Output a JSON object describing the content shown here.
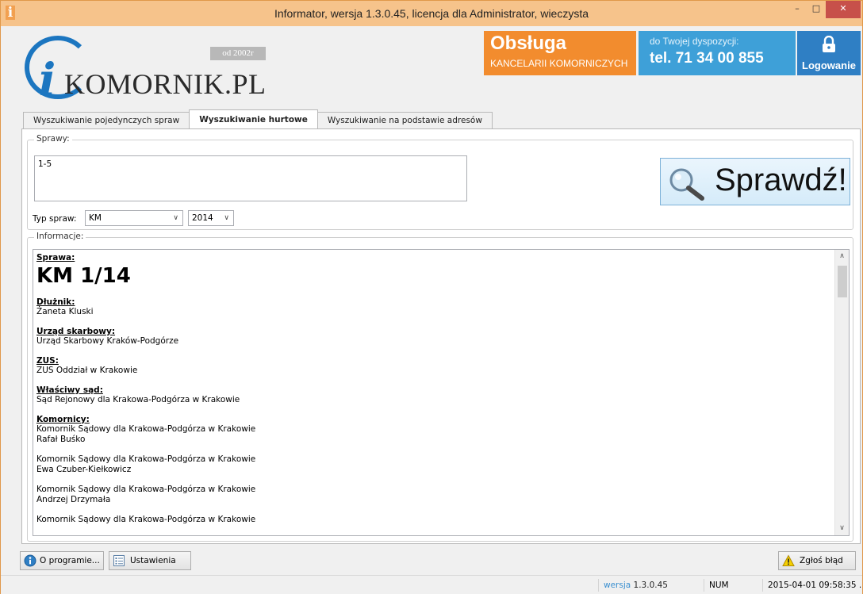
{
  "window": {
    "title": "Informator, wersja 1.3.0.45, licencja dla Administrator, wieczysta",
    "app_icon": "i",
    "min_label": "–",
    "max_label": "□",
    "close_label": "✕"
  },
  "header": {
    "logo_letter": "i",
    "logo_text": "KOMORNIK.PL",
    "logo_since": "od 2002r",
    "service_title": "Obsługa",
    "service_subtitle": "KANCELARII KOMORNICZYCH",
    "phone_label": "do Twojej dyspozycji:",
    "phone_number": "tel. 71 34 00 855",
    "login_label": "Logowanie",
    "colors": {
      "orange": "#f28c2e",
      "blue_light": "#3ea0d8",
      "blue_dark": "#2f7fc4"
    }
  },
  "tabs": [
    {
      "label": "Wyszukiwanie pojedynczych spraw",
      "active": false
    },
    {
      "label": "Wyszukiwanie hurtowe",
      "active": true
    },
    {
      "label": "Wyszukiwanie na podstawie adresów",
      "active": false
    }
  ],
  "sprawy": {
    "group_label": "Sprawy:",
    "input_value": "1-5",
    "type_label": "Typ spraw:",
    "type_selected": "KM",
    "year_selected": "2014",
    "check_button": "Sprawdź!"
  },
  "info": {
    "group_label": "Informacje:",
    "sprawa_label": "Sprawa:",
    "case_number": "KM 1/14",
    "dluznik_label": "Dłużnik:",
    "dluznik": "Żaneta Kluski",
    "urzad_label": "Urząd skarbowy:",
    "urzad": "Urząd Skarbowy Kraków-Podgórze",
    "zus_label": "ZUS:",
    "zus": "ZUS Oddział w Krakowie",
    "sad_label": "Właściwy sąd:",
    "sad": "Sąd Rejonowy dla Krakowa-Podgórza w Krakowie",
    "komornicy_label": "Komornicy:",
    "komornicy": [
      {
        "office": "Komornik Sądowy dla Krakowa-Podgórza w Krakowie",
        "name": "Rafał Buśko"
      },
      {
        "office": "Komornik Sądowy dla Krakowa-Podgórza w Krakowie",
        "name": "Ewa Czuber-Kiełkowicz"
      },
      {
        "office": "Komornik Sądowy dla Krakowa-Podgórza w Krakowie",
        "name": "Andrzej Drzymała"
      },
      {
        "office": "Komornik Sądowy dla Krakowa-Podgórza w Krakowie",
        "name": ""
      }
    ]
  },
  "bottom": {
    "about": "O programie...",
    "settings": "Ustawienia",
    "report": "Zgłoś błąd"
  },
  "status": {
    "version_label": "wersja",
    "version": "1.3.0.45",
    "num": "NUM",
    "datetime": "2015-04-01 09:58:35 ."
  }
}
